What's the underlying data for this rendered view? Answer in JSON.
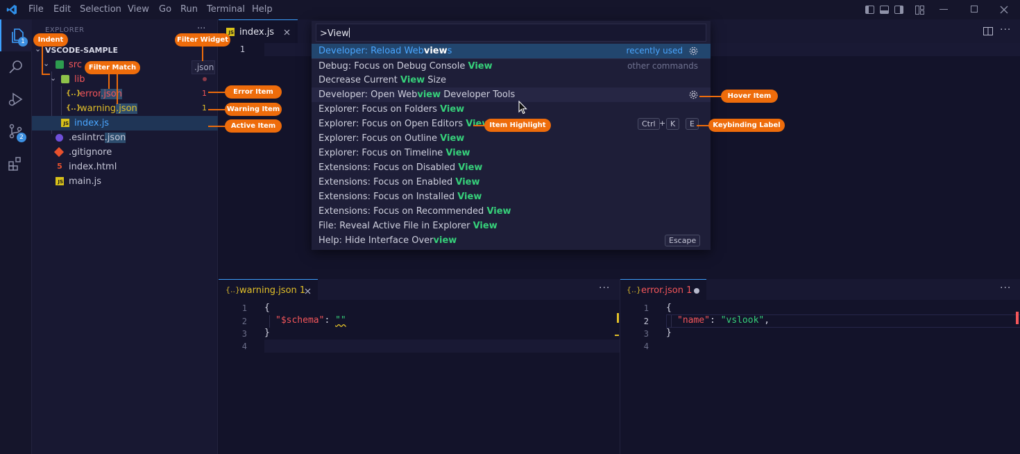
{
  "menu": [
    "File",
    "Edit",
    "Selection",
    "View",
    "Go",
    "Run",
    "Terminal",
    "Help"
  ],
  "activity": {
    "explorer_badge": "1",
    "scm_badge": "2"
  },
  "sidebar": {
    "title": "EXPLORER",
    "root": "VSCODE-SAMPLE",
    "filter_widget_value": ".json",
    "items": [
      {
        "label": "src"
      },
      {
        "label": "lib"
      },
      {
        "label_pre": "error",
        "label_match": ".json",
        "count": "1"
      },
      {
        "label_pre": "warning",
        "label_match": ".json",
        "count": "1"
      },
      {
        "label": "index.js"
      },
      {
        "label_pre": ".eslintrc",
        "label_match": ".json"
      },
      {
        "label": ".gitignore"
      },
      {
        "label": "index.html"
      },
      {
        "label": "main.js"
      }
    ]
  },
  "editor_top": {
    "tab_label": "index.js",
    "line": "1"
  },
  "quick_pick": {
    "input_value": ">View",
    "rows": [
      {
        "pre": "Developer: Reload Web",
        "match": "view",
        "post": "s",
        "right": "recently used"
      },
      {
        "pre": "Debug: Focus on Debug Console ",
        "match": "View",
        "post": "",
        "right": "other commands"
      },
      {
        "pre": "Decrease Current ",
        "match": "View",
        "post": " Size"
      },
      {
        "pre": "Developer: Open Web",
        "match": "view",
        "post": " Developer Tools"
      },
      {
        "pre": "Explorer: Focus on Folders ",
        "match": "View",
        "post": ""
      },
      {
        "pre": "Explorer: Focus on Open Editors ",
        "match": "View",
        "post": "",
        "keys": [
          "Ctrl",
          "+",
          "K",
          "E"
        ]
      },
      {
        "pre": "Explorer: Focus on Outline ",
        "match": "View",
        "post": ""
      },
      {
        "pre": "Explorer: Focus on Timeline ",
        "match": "View",
        "post": ""
      },
      {
        "pre": "Extensions: Focus on Disabled ",
        "match": "View",
        "post": ""
      },
      {
        "pre": "Extensions: Focus on Enabled ",
        "match": "View",
        "post": ""
      },
      {
        "pre": "Extensions: Focus on Installed ",
        "match": "View",
        "post": ""
      },
      {
        "pre": "Extensions: Focus on Recommended ",
        "match": "View",
        "post": ""
      },
      {
        "pre": "File: Reveal Active File in Explorer ",
        "match": "View",
        "post": ""
      },
      {
        "pre": "Help: Hide Interface Over",
        "match": "view",
        "post": "",
        "key": "Escape"
      }
    ]
  },
  "pane_left": {
    "tab_label": "warning.json",
    "tab_count": "1",
    "lines": [
      "1",
      "2",
      "3",
      "4"
    ],
    "code": {
      "l1": "{",
      "key": "\"$schema\"",
      "colon": ": ",
      "val": "\"\"",
      "l3": "}"
    }
  },
  "pane_right": {
    "tab_label": "error.json",
    "tab_count": "1",
    "lines": [
      "1",
      "2",
      "3",
      "4"
    ],
    "code": {
      "l1": "{",
      "key": "\"name\"",
      "colon": ": ",
      "val": "\"vslook\"",
      "comma": ",",
      "l3": "}"
    }
  },
  "annotations": {
    "indent": "Indent",
    "filter_widget": "Filter Widget",
    "filter_match": "Filter Match",
    "error_item": "Error Item",
    "warning_item": "Warning Item",
    "active_item": "Active Item",
    "hover_item": "Hover Item",
    "item_highlight": "Item Highlight",
    "keybinding_label": "Keybinding Label"
  },
  "colors": {
    "accent": "#3ca0ff",
    "match": "#36d07a",
    "error": "#f4565a",
    "warning": "#e2c029",
    "annotation": "#ee6c0b"
  }
}
